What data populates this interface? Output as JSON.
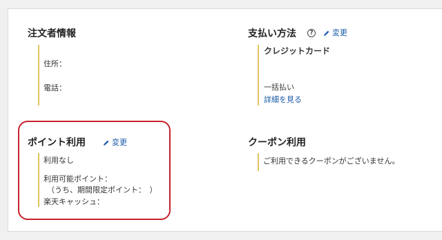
{
  "order_info": {
    "title": "注文者情報",
    "address_label": "住所：",
    "phone_label": "電話："
  },
  "payment": {
    "title": "支払い方法",
    "help_icon": "question-circle-icon",
    "change_label": "変更",
    "method": "クレジットカード",
    "installment": "一括払い",
    "details_link": "詳細を見る"
  },
  "points": {
    "title": "ポイント利用",
    "change_label": "変更",
    "usage": "利用なし",
    "available_label": "利用可能ポイント：",
    "limited_label": "（うち、期間限定ポイント：　）",
    "cash_label": "楽天キャッシュ："
  },
  "coupon": {
    "title": "クーポン利用",
    "message": "ご利用できるクーポンがございません。"
  },
  "colors": {
    "accent_bar": "#e0c45c",
    "link": "#1a5aa8",
    "highlight": "#c8202a"
  }
}
